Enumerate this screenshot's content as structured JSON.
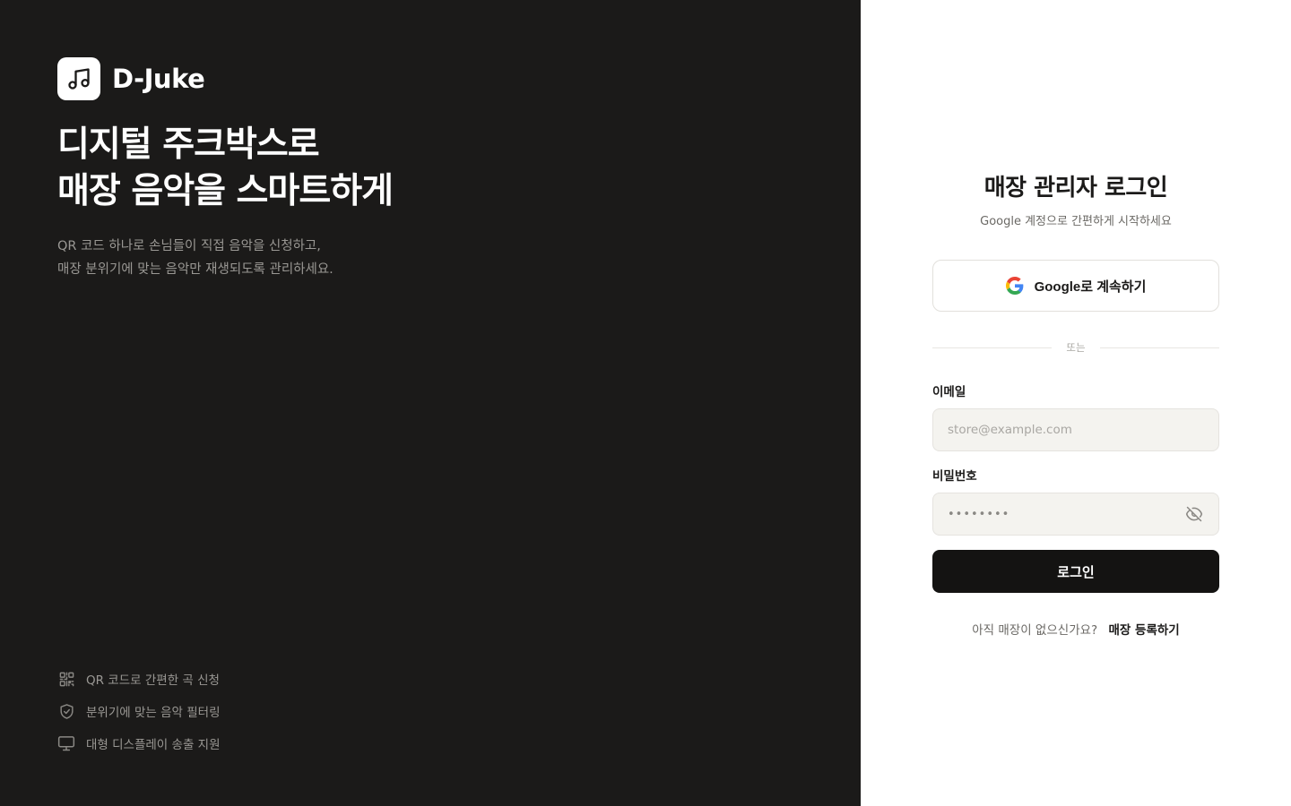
{
  "brand": {
    "name": "D-Juke",
    "logo_icon": "music-note-icon"
  },
  "hero": {
    "headline_line1": "디지털 주크박스로",
    "headline_line2": "매장 음악을 스마트하게",
    "sub_line1": "QR 코드 하나로 손님들이 직접 음악을 신청하고,",
    "sub_line2": "매장 분위기에 맞는 음악만 재생되도록 관리하세요."
  },
  "features": [
    {
      "icon": "qr-code-icon",
      "label": "QR 코드로 간편한 곡 신청"
    },
    {
      "icon": "shield-check-icon",
      "label": "분위기에 맞는 음악 필터링"
    },
    {
      "icon": "monitor-icon",
      "label": "대형 디스플레이 송출 지원"
    }
  ],
  "login": {
    "title": "매장 관리자 로그인",
    "subtitle": "Google 계정으로 간편하게 시작하세요",
    "google_label": "Google로 계속하기",
    "divider": "또는",
    "email_label": "이메일",
    "email_placeholder": "store@example.com",
    "password_label": "비밀번호",
    "password_value": "••••••••",
    "submit_label": "로그인",
    "signup_question": "아직 매장이 없으신가요?",
    "signup_link": "매장 등록하기"
  },
  "colors": {
    "left_bg": "#1b1a19",
    "input_bg": "#f4f3ef",
    "primary_button": "#141312",
    "muted_text": "#9a9894"
  }
}
